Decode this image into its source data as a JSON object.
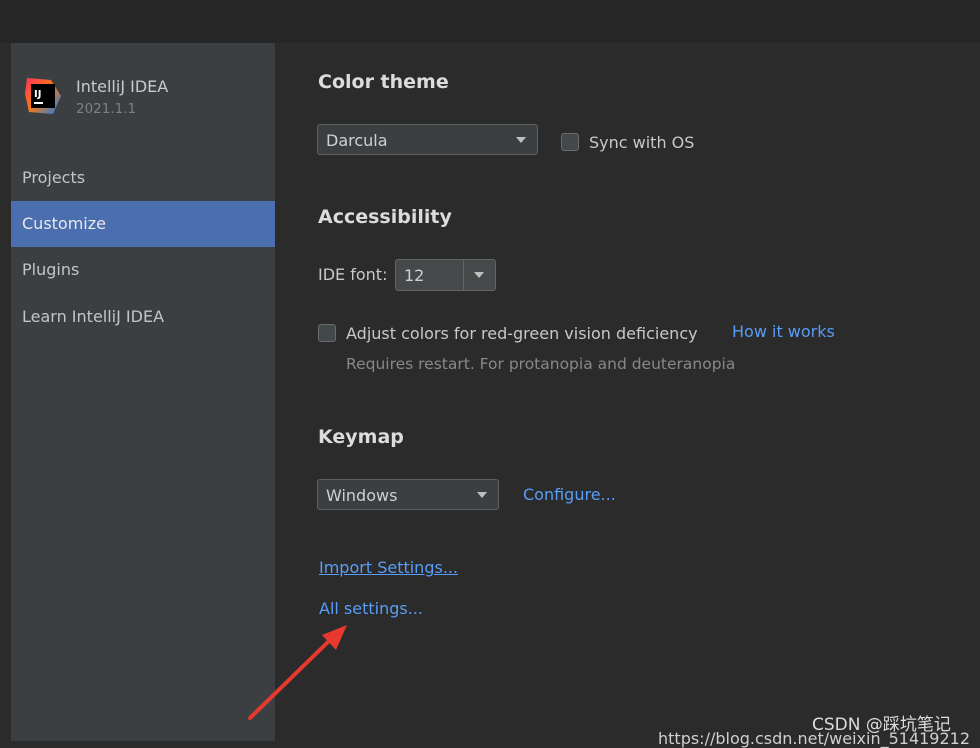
{
  "app": {
    "name": "IntelliJ IDEA",
    "version": "2021.1.1",
    "logo_letters": "IJ",
    "logo_icon": "intellij-logo-icon"
  },
  "sidebar": {
    "items": [
      {
        "label": "Projects",
        "active": false
      },
      {
        "label": "Customize",
        "active": true
      },
      {
        "label": "Plugins",
        "active": false
      },
      {
        "label": "Learn IntelliJ IDEA",
        "active": false
      }
    ]
  },
  "color_theme": {
    "title": "Color theme",
    "selected": "Darcula",
    "sync_label": "Sync with OS",
    "sync_checked": false
  },
  "accessibility": {
    "title": "Accessibility",
    "ide_font_label": "IDE font:",
    "ide_font_value": "12",
    "adjust_colors_label": "Adjust colors for red-green vision deficiency",
    "adjust_colors_checked": false,
    "how_it_works_link": "How it works",
    "restart_hint": "Requires restart. For protanopia and deuteranopia"
  },
  "keymap": {
    "title": "Keymap",
    "selected": "Windows",
    "configure_link": "Configure..."
  },
  "links": {
    "import_settings": "Import Settings...",
    "all_settings": "All settings..."
  },
  "watermark": {
    "text": "CSDN @踩坑笔记",
    "url": "https://blog.csdn.net/weixin_51419212"
  },
  "colors": {
    "accent": "#4b6eaf",
    "link": "#589df6",
    "annotation_arrow": "#e8392f"
  }
}
